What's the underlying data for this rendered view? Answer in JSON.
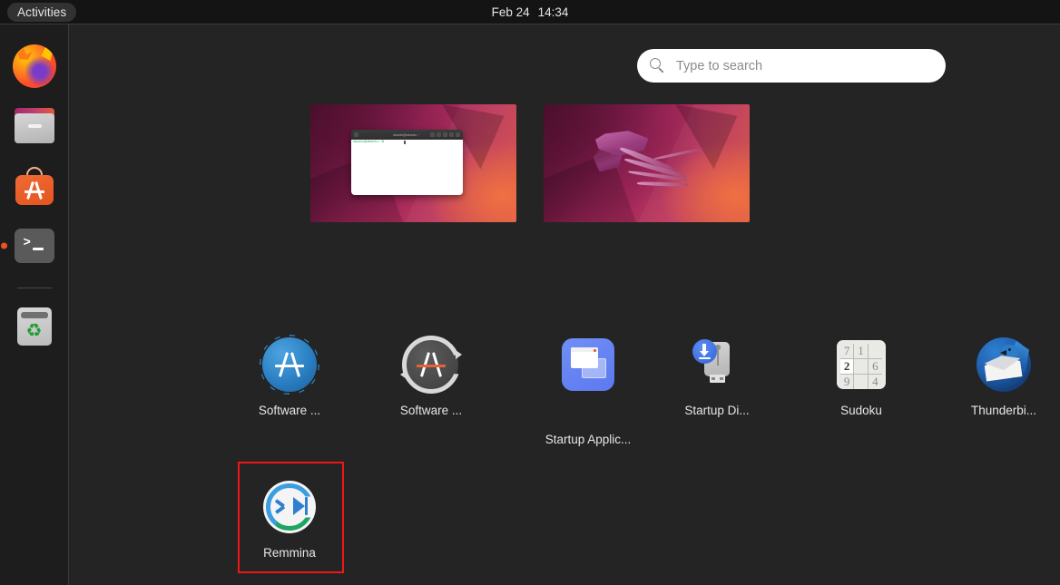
{
  "topbar": {
    "activities_label": "Activities",
    "clock_date": "Feb 24",
    "clock_time": "14:34"
  },
  "dock": {
    "items": [
      {
        "name": "firefox",
        "label": "Firefox",
        "running": false
      },
      {
        "name": "files",
        "label": "Files",
        "running": false
      },
      {
        "name": "ubuntu-software",
        "label": "Ubuntu Software",
        "running": false
      },
      {
        "name": "terminal",
        "label": "Terminal",
        "running": true
      },
      {
        "name": "trash",
        "label": "Trash",
        "running": false
      }
    ]
  },
  "search": {
    "placeholder": "Type to search",
    "value": "",
    "icon": "search-icon"
  },
  "workspaces": [
    {
      "index": 1,
      "has_window": true,
      "window": {
        "title": "ubuntu@ubuntu: ~",
        "prompt": "ubuntu@ubuntu:~$"
      }
    },
    {
      "index": 2,
      "has_window": false,
      "window": null
    }
  ],
  "apps": [
    {
      "name": "software-updates",
      "label": "Software ...",
      "icon": "software-updates-icon",
      "wrapped": false
    },
    {
      "name": "software-updater",
      "label": "Software ...",
      "icon": "software-updater-icon",
      "wrapped": false
    },
    {
      "name": "startup-applications",
      "label": "Startup Applic...",
      "icon": "startup-applications-icon",
      "wrapped": true
    },
    {
      "name": "startup-disk-creator",
      "label": "Startup Di...",
      "icon": "startup-disk-creator-icon",
      "wrapped": false
    },
    {
      "name": "sudoku",
      "label": "Sudoku",
      "icon": "sudoku-icon",
      "wrapped": false
    },
    {
      "name": "thunderbird",
      "label": "Thunderbi...",
      "icon": "thunderbird-icon",
      "wrapped": false
    },
    {
      "name": "remmina",
      "label": "Remmina",
      "icon": "remmina-icon",
      "wrapped": false,
      "highlighted": true
    }
  ],
  "sudoku_cells": [
    "7",
    "1",
    "",
    "2",
    "",
    "6",
    "9",
    "",
    "4"
  ],
  "colors": {
    "background": "#242424",
    "topbar": "#141414",
    "dock": "#1d1d1d",
    "accent": "#e95420",
    "highlight_border": "#f01616",
    "text": "#e9e6e3"
  }
}
